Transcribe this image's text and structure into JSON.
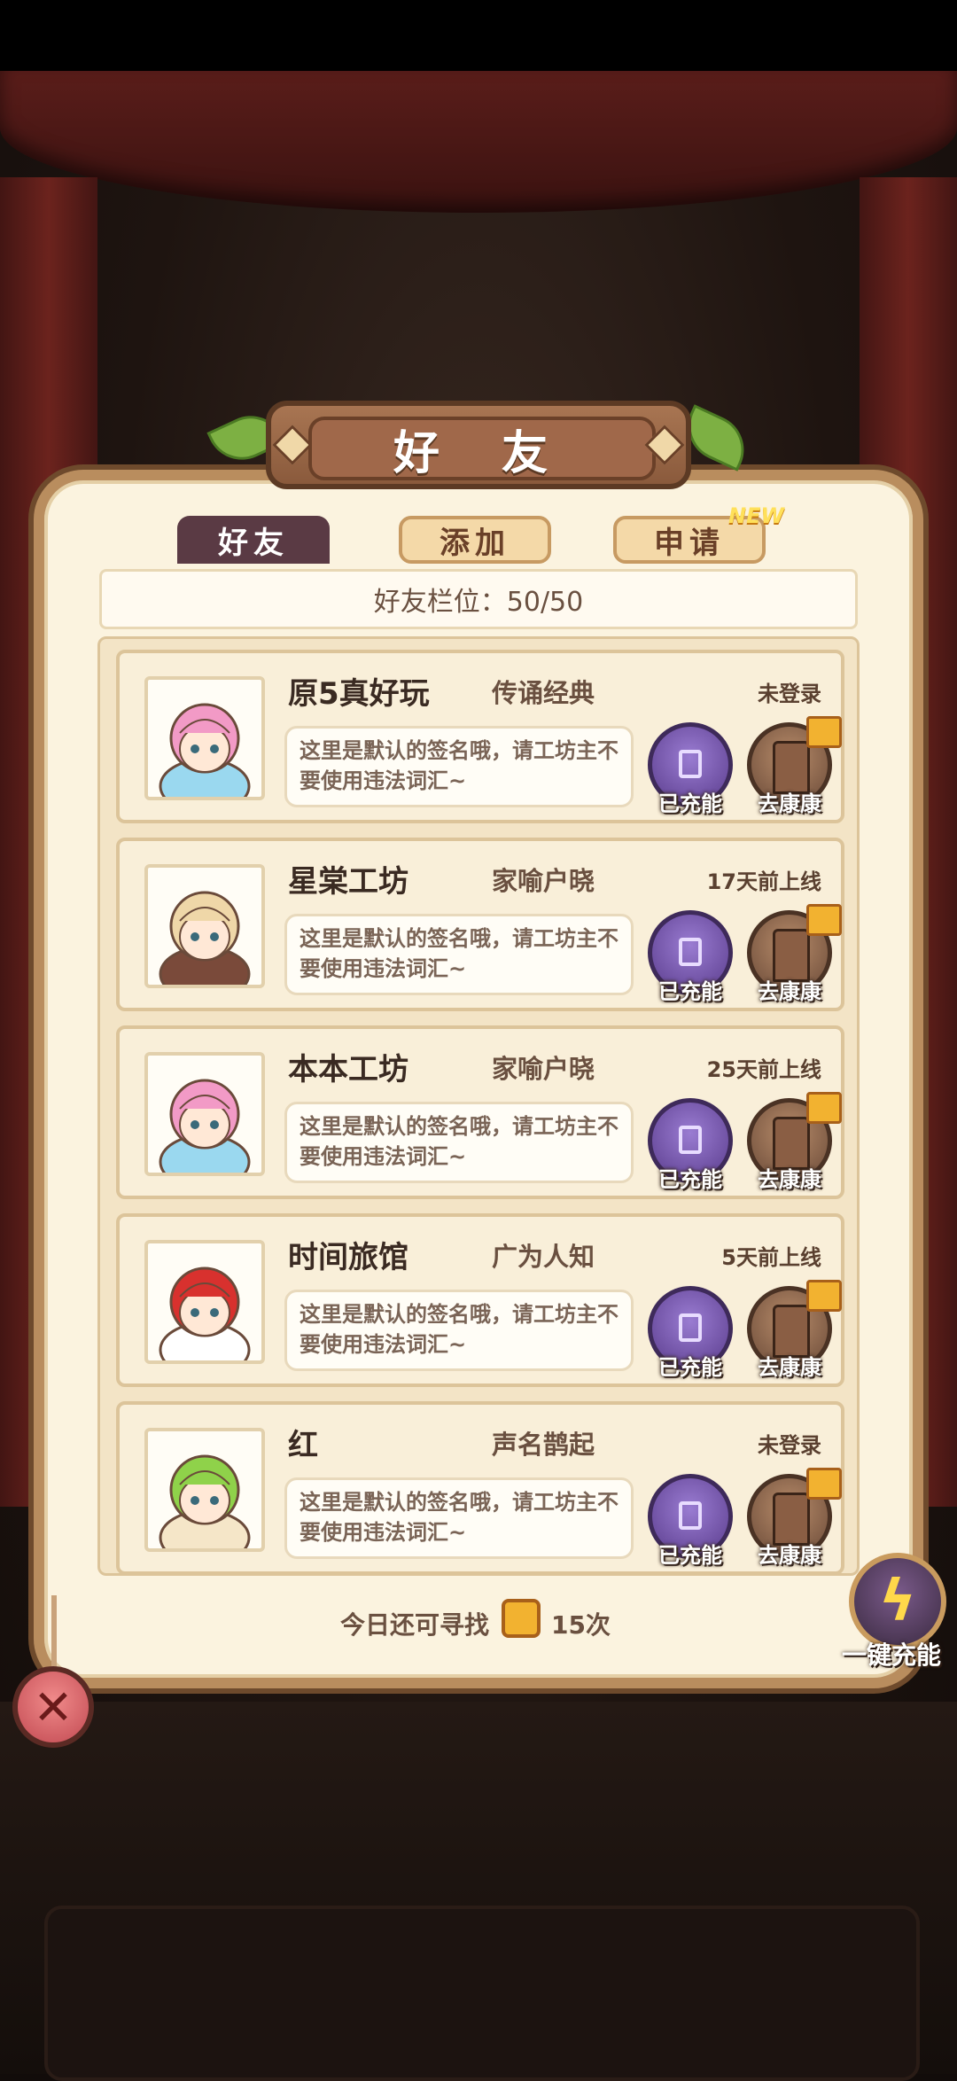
{
  "header": {
    "title": "好 友"
  },
  "tabs": [
    {
      "label": "好友"
    },
    {
      "label": "添加"
    },
    {
      "label": "申请",
      "badge": "NEW"
    }
  ],
  "slots": {
    "text": "好友栏位：50/50"
  },
  "actions": {
    "charge": "已充能",
    "visit": "去康康"
  },
  "friends": [
    {
      "name": "原5真好玩",
      "title": "传诵经典",
      "status": "未登录",
      "signature": "这里是默认的签名哦，请工坊主不要使用违法词汇~",
      "hair": "#f29ac6",
      "shirt": "#9ad8ef"
    },
    {
      "name": "星棠工坊",
      "title": "家喻户晓",
      "status": "17天前上线",
      "signature": "这里是默认的签名哦，请工坊主不要使用违法词汇~",
      "hair": "#efd7a8",
      "shirt": "#7a4a3a"
    },
    {
      "name": "本本工坊",
      "title": "家喻户晓",
      "status": "25天前上线",
      "signature": "这里是默认的签名哦，请工坊主不要使用违法词汇~",
      "hair": "#f29ac6",
      "shirt": "#9ad8ef"
    },
    {
      "name": "时间旅馆",
      "title": "广为人知",
      "status": "5天前上线",
      "signature": "这里是默认的签名哦，请工坊主不要使用违法词汇~",
      "hair": "#d8312e",
      "shirt": "#ffffff"
    },
    {
      "name": "红",
      "title": "声名鹊起",
      "status": "未登录",
      "signature": "这里是默认的签名哦，请工坊主不要使用违法词汇~",
      "hair": "#8fd24a",
      "shirt": "#f5e6c8"
    }
  ],
  "footer": {
    "text": "今日还可寻找",
    "count": "15次"
  },
  "oneclick": {
    "label": "一键充能"
  },
  "colors": {
    "panel": "#fbf3df",
    "frame": "#b98d5e",
    "tab_active": "#5a3a44",
    "charge": "#5a3c8c"
  }
}
